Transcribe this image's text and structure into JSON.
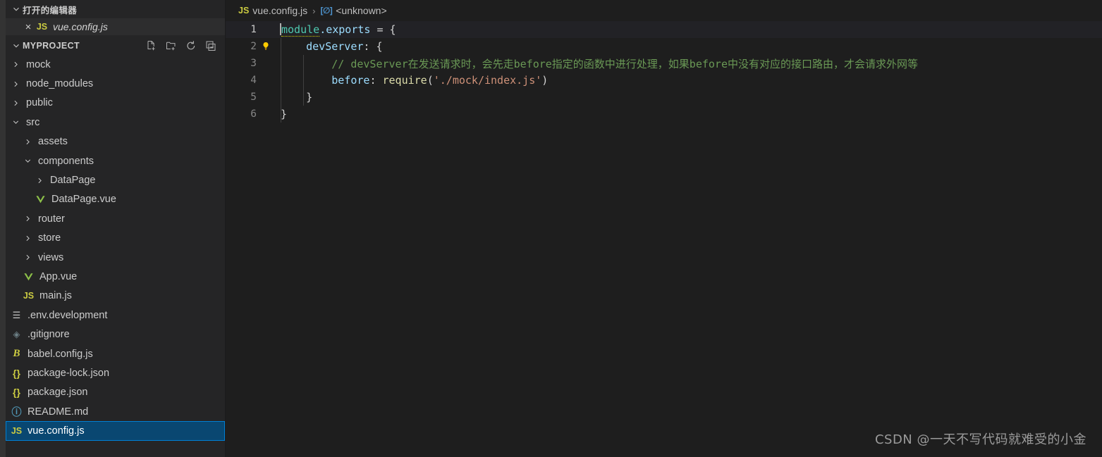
{
  "sidebar": {
    "open_editors": {
      "title": "打开的编辑器",
      "twisty": "chevron-down",
      "items": [
        {
          "close": "×",
          "icon": "js-icon",
          "icon_text": "JS",
          "name": "vue.config.js"
        }
      ]
    },
    "explorer": {
      "title": "MYPROJECT",
      "twisty": "chevron-down",
      "actions": [
        {
          "name": "new-file",
          "tooltip": "新建文件"
        },
        {
          "name": "new-folder",
          "tooltip": "新建文件夹"
        },
        {
          "name": "refresh",
          "tooltip": "刷新资源管理器"
        },
        {
          "name": "collapse-all",
          "tooltip": "在资源管理器中折叠文件夹"
        }
      ]
    },
    "tree": [
      {
        "label": "mock",
        "type": "folder",
        "state": "collapsed",
        "depth": 1
      },
      {
        "label": "node_modules",
        "type": "folder",
        "state": "collapsed",
        "depth": 1
      },
      {
        "label": "public",
        "type": "folder",
        "state": "collapsed",
        "depth": 1
      },
      {
        "label": "src",
        "type": "folder",
        "state": "expanded",
        "depth": 1
      },
      {
        "label": "assets",
        "type": "folder",
        "state": "collapsed",
        "depth": 2
      },
      {
        "label": "components",
        "type": "folder",
        "state": "expanded",
        "depth": 2
      },
      {
        "label": "DataPage",
        "type": "folder",
        "state": "collapsed",
        "depth": 3
      },
      {
        "label": "DataPage.vue",
        "type": "file",
        "icon": "vue-icon",
        "depth": 3
      },
      {
        "label": "router",
        "type": "folder",
        "state": "collapsed",
        "depth": 2
      },
      {
        "label": "store",
        "type": "folder",
        "state": "collapsed",
        "depth": 2
      },
      {
        "label": "views",
        "type": "folder",
        "state": "collapsed",
        "depth": 2
      },
      {
        "label": "App.vue",
        "type": "file",
        "icon": "vue-icon",
        "depth": 2
      },
      {
        "label": "main.js",
        "type": "file",
        "icon": "js-icon",
        "icon_text": "JS",
        "depth": 2
      },
      {
        "label": ".env.development",
        "type": "file",
        "icon": "env-icon",
        "icon_text": "☰",
        "depth": 1
      },
      {
        "label": ".gitignore",
        "type": "file",
        "icon": "git-icon",
        "icon_text": "◈",
        "depth": 1
      },
      {
        "label": "babel.config.js",
        "type": "file",
        "icon": "babel-icon",
        "icon_text": "B",
        "depth": 1
      },
      {
        "label": "package-lock.json",
        "type": "file",
        "icon": "json-icon",
        "icon_text": "{}",
        "depth": 1
      },
      {
        "label": "package.json",
        "type": "file",
        "icon": "json-icon",
        "icon_text": "{}",
        "depth": 1
      },
      {
        "label": "README.md",
        "type": "file",
        "icon": "info-icon",
        "icon_text": "ⓘ",
        "depth": 1
      },
      {
        "label": "vue.config.js",
        "type": "file",
        "icon": "js-icon",
        "icon_text": "JS",
        "depth": 1,
        "selected": true
      }
    ]
  },
  "editor": {
    "breadcrumb": {
      "file_icon_text": "JS",
      "file": "vue.config.js",
      "separator": "›",
      "symbol_icon_text": "[∅]",
      "symbol": "<unknown>"
    },
    "line_numbers": [
      "1",
      "2",
      "3",
      "4",
      "5",
      "6"
    ],
    "active_line": 1,
    "glyph_hint": {
      "line": 2,
      "icon": "lightbulb-icon",
      "glyph": "💡"
    },
    "code": {
      "l1_module": "module",
      "l1_dot_exports": ".exports",
      "l1_assign": " = {",
      "l2_key": "devServer",
      "l2_rest": ": {",
      "l3_comment": "// devServer在发送请求时，会先走before指定的函数中进行处理，如果before中没有对应的接口路由，才会请求外网等",
      "l4_key": "before",
      "l4_colon": ": ",
      "l4_func": "require",
      "l4_paren_open": "(",
      "l4_string": "'./mock/index.js'",
      "l4_paren_close": ")",
      "l5_brace": "}",
      "l6_brace": "}"
    }
  },
  "watermark": "CSDN @一天不写代码就难受的小金",
  "colors": {
    "sidebar_bg": "#252526",
    "editor_bg": "#1e1e1e",
    "selection_bg": "#094771",
    "selection_border": "#007fd4",
    "js_yellow": "#cbcb41",
    "vue_green": "#8dc149",
    "comment_green": "#6A9955",
    "string_orange": "#CE9178",
    "property_blue": "#9CDCFE",
    "teal": "#4EC9B0",
    "function_yellow": "#DCDCAA"
  }
}
